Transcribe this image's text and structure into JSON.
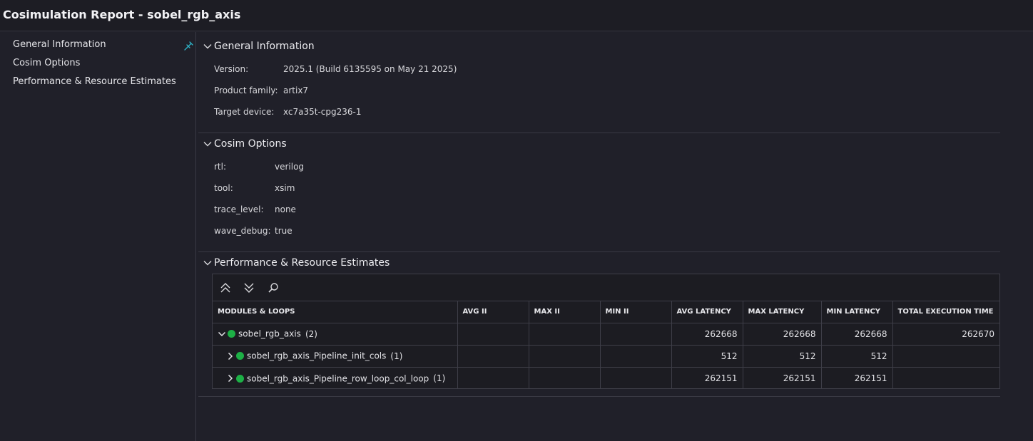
{
  "window": {
    "title": "Cosimulation Report - sobel_rgb_axis"
  },
  "sidebar": {
    "items": [
      {
        "label": "General Information"
      },
      {
        "label": "Cosim Options"
      },
      {
        "label": "Performance & Resource Estimates"
      }
    ],
    "pin_icon": "pin-icon"
  },
  "general_information": {
    "title": "General Information",
    "rows": [
      {
        "label": "Version:",
        "value": "2025.1 (Build 6135595 on May 21 2025)"
      },
      {
        "label": "Product family:",
        "value": "artix7"
      },
      {
        "label": "Target device:",
        "value": "xc7a35t-cpg236-1"
      }
    ]
  },
  "cosim_options": {
    "title": "Cosim Options",
    "rows": [
      {
        "label": "rtl:",
        "value": "verilog"
      },
      {
        "label": "tool:",
        "value": "xsim"
      },
      {
        "label": "trace_level:",
        "value": "none"
      },
      {
        "label": "wave_debug:",
        "value": "true"
      }
    ]
  },
  "performance": {
    "title": "Performance & Resource Estimates",
    "toolbar": {
      "icons": [
        "collapse-all-icon",
        "expand-all-icon",
        "search-icon"
      ]
    },
    "columns": [
      "MODULES & LOOPS",
      "AVG II",
      "MAX II",
      "MIN II",
      "AVG LATENCY",
      "MAX LATENCY",
      "MIN LATENCY",
      "TOTAL EXECUTION TIME"
    ],
    "rows": [
      {
        "name": "sobel_rgb_axis",
        "count": "(2)",
        "expanded": true,
        "avg_ii": "",
        "max_ii": "",
        "min_ii": "",
        "avg_latency": "262668",
        "max_latency": "262668",
        "min_latency": "262668",
        "total_exec": "262670"
      },
      {
        "name": "sobel_rgb_axis_Pipeline_init_cols",
        "count": "(1)",
        "expanded": false,
        "avg_ii": "",
        "max_ii": "",
        "min_ii": "",
        "avg_latency": "512",
        "max_latency": "512",
        "min_latency": "512",
        "total_exec": ""
      },
      {
        "name": "sobel_rgb_axis_Pipeline_row_loop_col_loop",
        "count": "(1)",
        "expanded": false,
        "avg_ii": "",
        "max_ii": "",
        "min_ii": "",
        "avg_latency": "262151",
        "max_latency": "262151",
        "min_latency": "262151",
        "total_exec": ""
      }
    ],
    "status_color": "#1db046"
  },
  "colors": {
    "background": "#202029",
    "titlebar": "#1d1d24",
    "accent": "#2fb5c9"
  }
}
